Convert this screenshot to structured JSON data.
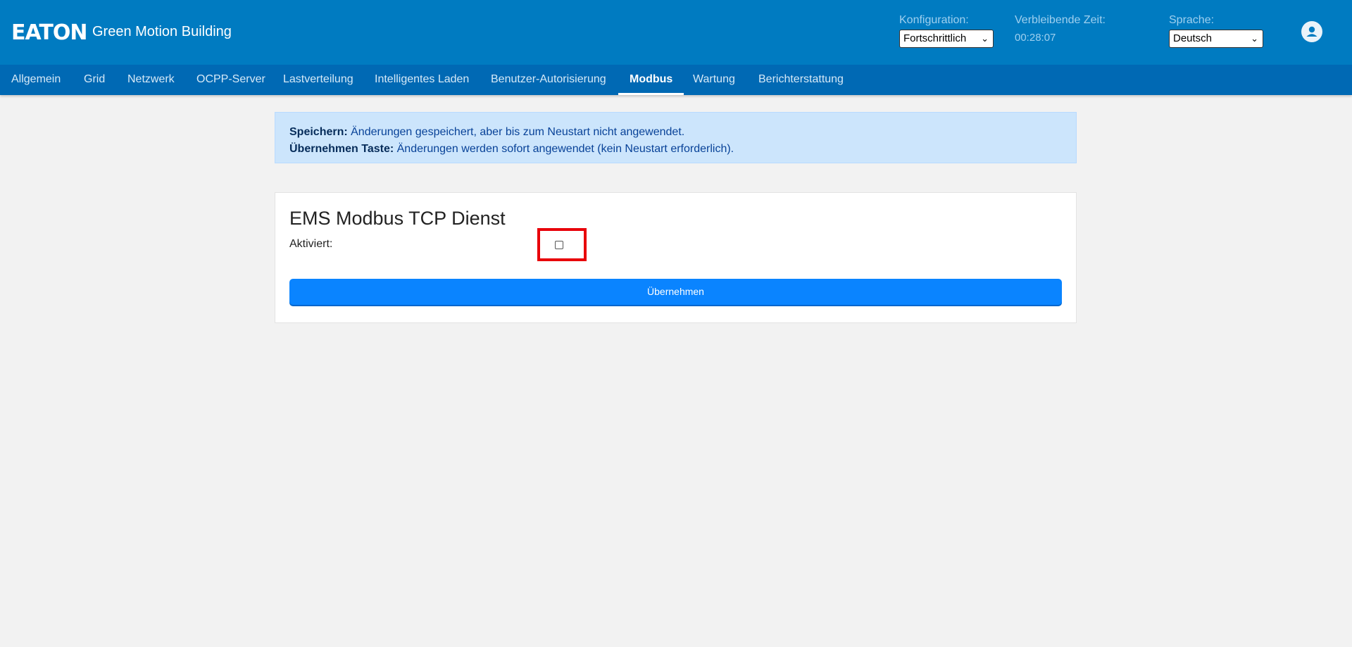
{
  "header": {
    "logo_text": "EATON",
    "app_title": "Green Motion Building",
    "config_label": "Konfiguration:",
    "config_value": "Fortschrittlich",
    "remaining_label": "Verbleibende Zeit:",
    "remaining_value": "00:28:07",
    "language_label": "Sprache:",
    "language_value": "Deutsch",
    "avatar_icon": "user-account-icon"
  },
  "nav": {
    "items": [
      {
        "label": "Allgemein"
      },
      {
        "label": "Grid"
      },
      {
        "label": "Netzwerk"
      },
      {
        "label": "OCPP-Server"
      },
      {
        "label": "Lastverteilung"
      },
      {
        "label": "Intelligentes Laden"
      },
      {
        "label": "Benutzer-Autorisierung"
      },
      {
        "label": "Modbus"
      },
      {
        "label": "Wartung"
      },
      {
        "label": "Berichterstattung"
      }
    ],
    "active": "Modbus"
  },
  "info": {
    "line1_bold": "Speichern:",
    "line1_text": " Änderungen gespeichert, aber bis zum Neustart nicht angewendet.",
    "line2_bold": "Übernehmen Taste:",
    "line2_text": " Änderungen werden sofort angewendet (kein Neustart erforderlich)."
  },
  "card": {
    "title": "EMS Modbus TCP Dienst",
    "enabled_label": "Aktiviert:",
    "enabled_checked": false,
    "apply_label": "Übernehmen"
  },
  "colors": {
    "header_bg": "#007bc1",
    "nav_bg": "#0069b4",
    "info_bg": "#cce5fc",
    "button_bg": "#0a84ff",
    "highlight": "#e8000a"
  }
}
